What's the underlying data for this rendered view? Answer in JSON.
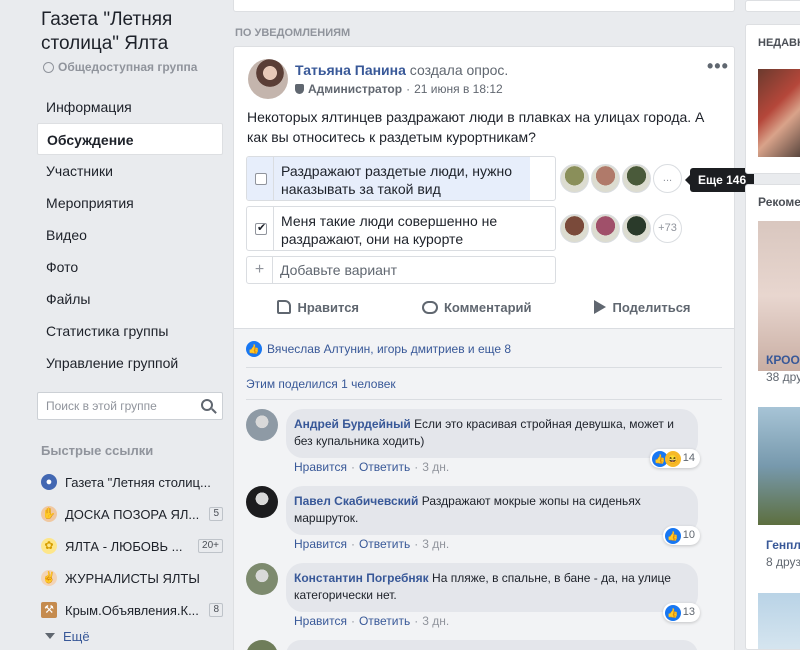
{
  "group": {
    "title": "Газета \"Летняя столица\" Ялта",
    "type": "Общедоступная группа"
  },
  "nav": [
    {
      "label": "Информация",
      "active": false
    },
    {
      "label": "Обсуждение",
      "active": true
    },
    {
      "label": "Участники",
      "active": false
    },
    {
      "label": "Мероприятия",
      "active": false
    },
    {
      "label": "Видео",
      "active": false
    },
    {
      "label": "Фото",
      "active": false
    },
    {
      "label": "Файлы",
      "active": false
    },
    {
      "label": "Статистика группы",
      "active": false
    },
    {
      "label": "Управление группой",
      "active": false
    }
  ],
  "search": {
    "placeholder": "Поиск в этой группе"
  },
  "quick_links": {
    "title": "Быстрые ссылки",
    "items": [
      {
        "label": "Газета \"Летняя столиц...",
        "badge": "",
        "icon": "group-icon"
      },
      {
        "label": "ДОСКА ПОЗОРА ЯЛ...",
        "badge": "5",
        "icon": "hand-icon"
      },
      {
        "label": "ЯЛТА - ЛЮБОВЬ ...",
        "badge": "20+",
        "icon": "flower-icon"
      },
      {
        "label": "ЖУРНАЛИСТЫ ЯЛТЫ",
        "badge": "",
        "icon": "rock-hand-icon"
      },
      {
        "label": "Крым.Объявления.К...",
        "badge": "8",
        "icon": "gavel-icon"
      }
    ],
    "more": "Ещё"
  },
  "feed": {
    "section_label": "ПО УВЕДОМЛЕНИЯМ",
    "post": {
      "author": "Татьяна Панина",
      "action": " создала опрос.",
      "role": "Администратор",
      "date": "21 июня в 18:12",
      "text": "Некоторых ялтинцев раздражают люди в плавках на улицах города. А как вы относитесь к раздетым курортникам?",
      "poll": [
        {
          "label": "Раздражают раздетые люди, нужно наказывать за такой вид",
          "checked": false,
          "fill": 0.92,
          "more_label": "...",
          "voter_colors": [
            "#8a8f5a",
            "#b07a6a",
            "#4a5a3a"
          ]
        },
        {
          "label": "Меня такие люди совершенно не раздражают, они на курорте",
          "checked": true,
          "fill": 0.0,
          "more_label": "+73",
          "voter_colors": [
            "#7a4a3a",
            "#a0506a",
            "#2a3a2a"
          ]
        }
      ],
      "tooltip": "Еще 146",
      "add_option_placeholder": "Добавьте вариант",
      "actions": {
        "like": "Нравится",
        "comment": "Комментарий",
        "share": "Поделиться"
      },
      "reactions_text": "Вячеслав Алтунин, игорь дмитриев и еще 8",
      "shares_text": "Этим поделился 1 человек",
      "comments": [
        {
          "author": "Андрей Бурдейный",
          "text": "Если это красивая стройная девушка, может и без купальника ходить)",
          "likes": "14",
          "haha": true,
          "like_label": "Нравится",
          "reply_label": "Ответить",
          "time": "3 дн.",
          "avatar_color": "#8e9aa5"
        },
        {
          "author": "Павел Скабичевский",
          "text": "Раздражают мокрые жопы на сиденьях маршруток.",
          "likes": "10",
          "haha": false,
          "like_label": "Нравится",
          "reply_label": "Ответить",
          "time": "3 дн.",
          "avatar_color": "#1c1c1e"
        },
        {
          "author": "Константин Погребняк",
          "text": "На пляже, в спальне, в бане - да, на улице категорически нет.",
          "likes": "13",
          "haha": false,
          "like_label": "Нравится",
          "reply_label": "Ответить",
          "time": "3 дн.",
          "avatar_color": "#7d8a6e"
        }
      ]
    }
  },
  "right": {
    "recent_label": "НЕДАВН",
    "recommended_label": "Рекоме",
    "suggestions": [
      {
        "name": "КРОО",
        "sub": "38 дру"
      },
      {
        "name": "Генпл",
        "sub": "8 друз"
      }
    ]
  },
  "colors": {
    "link": "#385898",
    "accent": "#1877f2",
    "bg": "#e9ebee"
  }
}
